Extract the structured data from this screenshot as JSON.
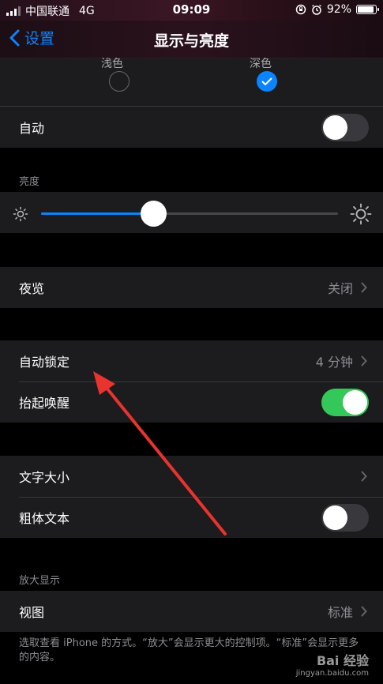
{
  "status_bar": {
    "carrier": "中国联通",
    "network": "4G",
    "time": "09:09",
    "battery": "92%"
  },
  "nav": {
    "back_label": "设置",
    "title": "显示与亮度"
  },
  "appearance": {
    "light_label": "浅色",
    "dark_label": "深色",
    "selected": "dark"
  },
  "auto_row": {
    "label": "自动",
    "toggle_on": false
  },
  "brightness": {
    "header": "亮度",
    "level_percent": 38
  },
  "night_shift": {
    "label": "夜览",
    "value": "关闭"
  },
  "auto_lock": {
    "label": "自动锁定",
    "value": "4 分钟"
  },
  "raise_to_wake": {
    "label": "抬起唤醒",
    "toggle_on": true
  },
  "text_size": {
    "label": "文字大小"
  },
  "bold_text": {
    "label": "粗体文本",
    "toggle_on": false
  },
  "display_zoom": {
    "header": "放大显示",
    "view_label": "视图",
    "view_value": "标准",
    "footnote": "选取查看 iPhone 的方式。“放大”会显示更大的控制项。“标准”会显示更多的内容。"
  },
  "watermark": {
    "brand": "Bai 经验",
    "url": "jingyan.baidu.com"
  },
  "colors": {
    "accent": "#0a84ff",
    "toggle_on": "#34c759",
    "annotation_arrow": "#e8332e"
  }
}
